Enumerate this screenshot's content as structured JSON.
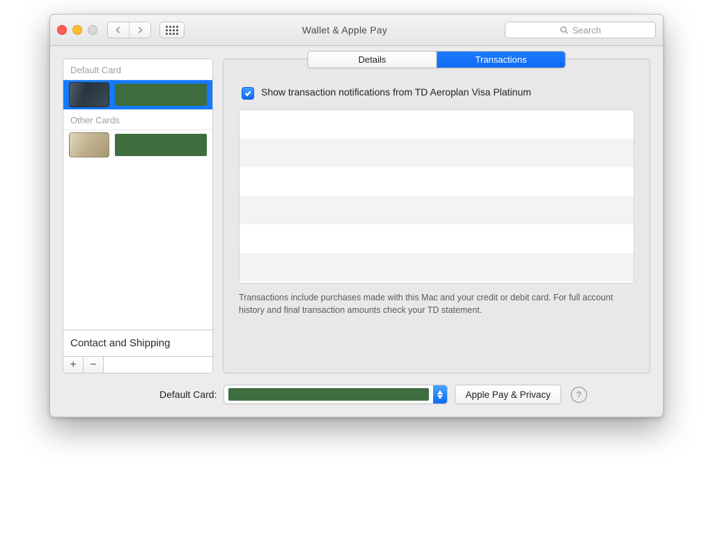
{
  "window": {
    "title": "Wallet & Apple Pay",
    "search_placeholder": "Search"
  },
  "sidebar": {
    "default_header": "Default Card",
    "other_header": "Other Cards",
    "default_card": {
      "name_redacted": true
    },
    "other_cards": [
      {
        "name_redacted": true
      }
    ],
    "contact_shipping_label": "Contact and Shipping",
    "add_label": "+",
    "remove_label": "−"
  },
  "tabs": {
    "details": "Details",
    "transactions": "Transactions",
    "active": "transactions"
  },
  "transactions_pane": {
    "checkbox_label": "Show transaction notifications from TD Aeroplan Visa Platinum",
    "checkbox_checked": true,
    "footer_note": "Transactions include purchases made with this Mac and your credit or debit card. For full account history and final transaction amounts check your TD statement."
  },
  "footer": {
    "default_card_label": "Default Card:",
    "default_card_value_redacted": true,
    "privacy_button": "Apple Pay & Privacy",
    "help_label": "?"
  }
}
